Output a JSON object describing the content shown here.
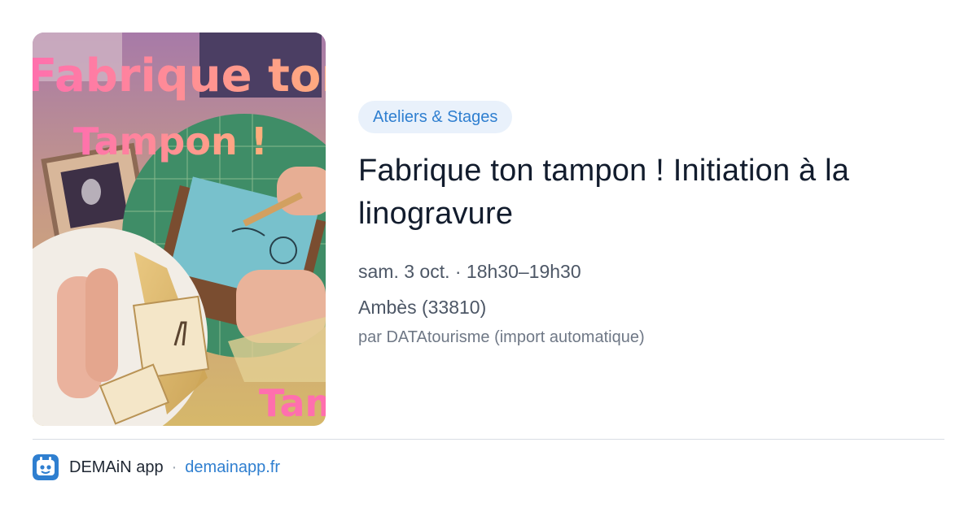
{
  "image": {
    "overlay_line1": "Fabrique ton",
    "overlay_line2": "Tampon !",
    "overlay_line3": "Tam"
  },
  "event": {
    "category": "Ateliers & Stages",
    "title": "Fabrique ton tampon ! Initiation à la linogravure",
    "date_time": "sam. 3 oct. · 18h30–19h30",
    "location": "Ambès (33810)",
    "source": "par DATAtourisme (import automatique)"
  },
  "footer": {
    "app_name": "DEMAiN app",
    "separator": "·",
    "domain": "demainapp.fr"
  },
  "colors": {
    "accent": "#2f7fd0",
    "chip_bg": "#e9f1fb",
    "title": "#121c2d",
    "overlay_pink": "#ff6fae",
    "overlay_peach": "#ffb07a"
  },
  "icons": {
    "app_logo": "demain-app-logo-icon"
  }
}
